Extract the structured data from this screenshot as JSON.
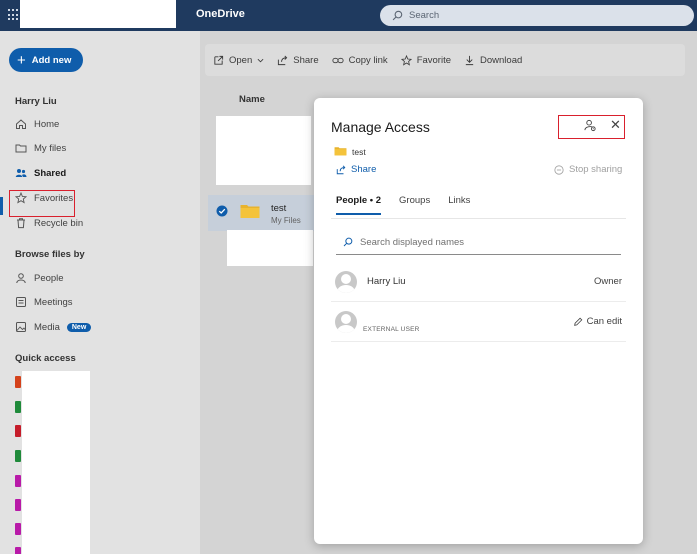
{
  "topbar": {
    "app_name": "OneDrive",
    "search_placeholder": "Search"
  },
  "nav": {
    "add_new_label": "Add new",
    "user_name": "Harry Liu",
    "items": [
      {
        "label": "Home",
        "icon": "home-icon"
      },
      {
        "label": "My files",
        "icon": "folder-icon"
      },
      {
        "label": "Shared",
        "icon": "people-icon",
        "active": true
      },
      {
        "label": "Favorites",
        "icon": "star-icon"
      },
      {
        "label": "Recycle bin",
        "icon": "trash-icon"
      }
    ],
    "browse_heading": "Browse files by",
    "browse_items": [
      {
        "label": "People",
        "icon": "person-icon"
      },
      {
        "label": "Meetings",
        "icon": "meetings-icon"
      },
      {
        "label": "Media",
        "icon": "image-icon",
        "badge": "New"
      }
    ],
    "quick_access_heading": "Quick access",
    "quick_access_colors": [
      "#d4421b",
      "#1f8a3a",
      "#c51c2a",
      "#1f8a3a",
      "#b81aa8",
      "#b81aa8",
      "#b81aa8",
      "#b81aa8"
    ]
  },
  "commandbar": {
    "open": "Open",
    "share": "Share",
    "copy_link": "Copy link",
    "favorite": "Favorite",
    "download": "Download"
  },
  "list": {
    "name_header": "Name",
    "selected_file": {
      "name": "test",
      "location": "My Files"
    }
  },
  "dialog": {
    "title": "Manage Access",
    "item_name": "test",
    "share_label": "Share",
    "stop_sharing_label": "Stop sharing",
    "tabs": [
      "People • 2",
      "Groups",
      "Links"
    ],
    "search_placeholder": "Search displayed names",
    "people": [
      {
        "name": "Harry Liu",
        "sub": "",
        "role": "Owner"
      },
      {
        "name": "",
        "sub": "EXTERNAL USER",
        "role": "Can edit"
      }
    ]
  },
  "colors": {
    "topbar": "#1f3a5f",
    "accent": "#0f5dab",
    "highlight_box": "#d9202d",
    "folder": "#f4c33b"
  }
}
